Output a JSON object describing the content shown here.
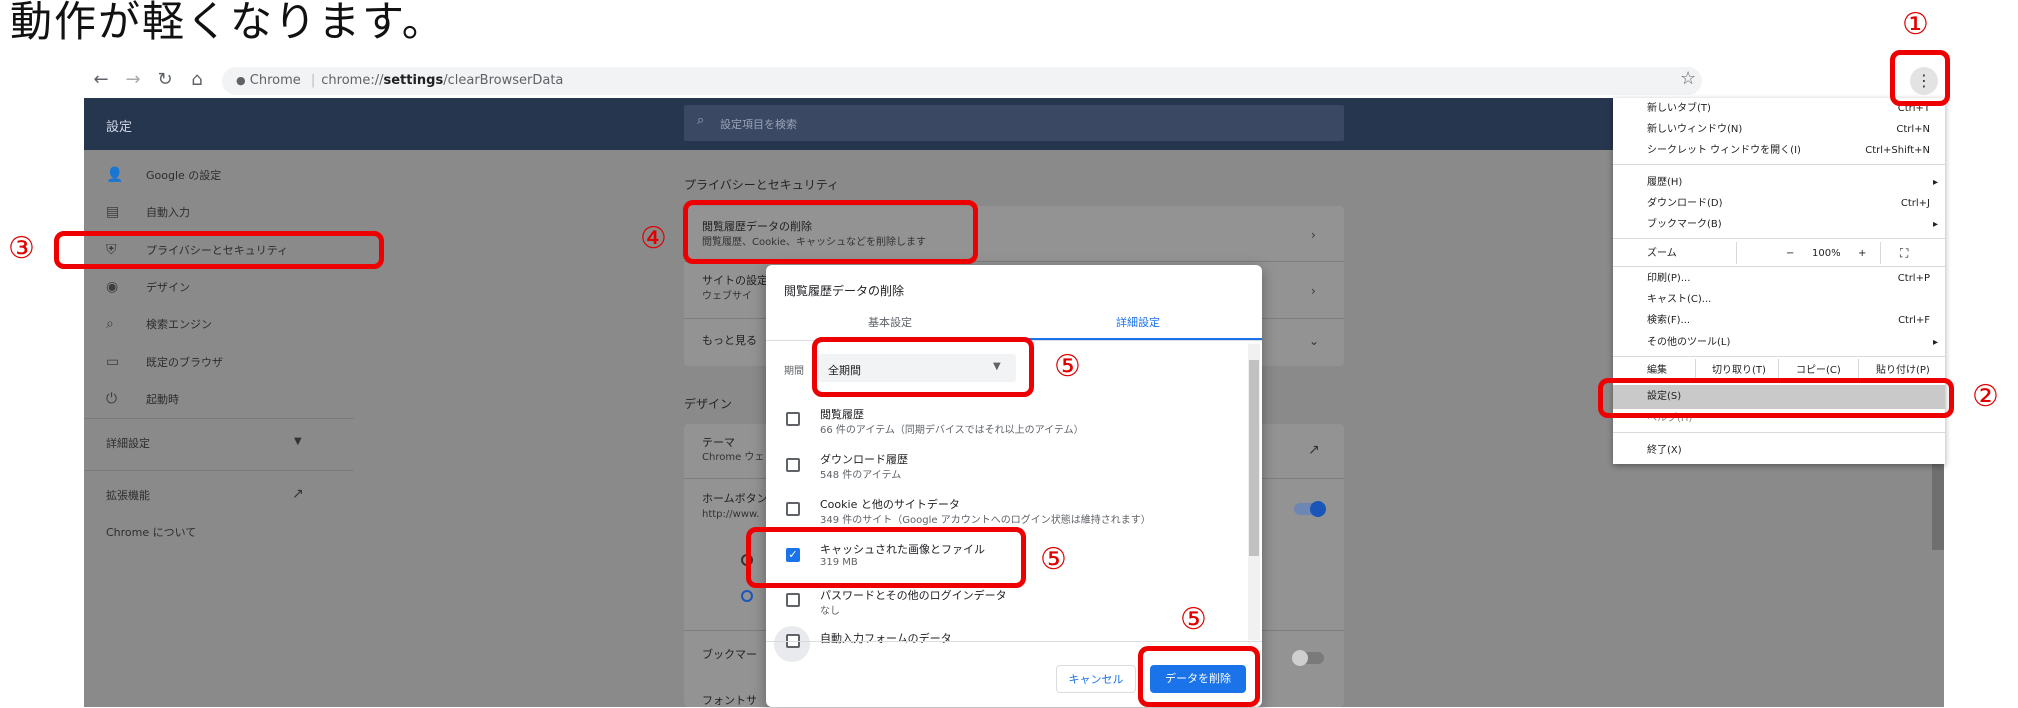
{
  "headline": "動作が軽くなります。",
  "browser": {
    "back_icon": "arrow-left-icon",
    "forward_icon": "arrow-right-icon",
    "reload_icon": "reload-icon",
    "home_icon": "home-icon",
    "site_label": "Chrome",
    "url_prefix": "chrome://",
    "url_bold": "settings",
    "url_suffix": "/clearBrowserData",
    "bookmark_star": "☆",
    "menu_dots": "⋮"
  },
  "settings": {
    "title": "設定",
    "search_placeholder": "設定項目を検索",
    "sidebar": [
      {
        "label": "Google の設定",
        "icon": "person-icon"
      },
      {
        "label": "自動入力",
        "icon": "clipboard-icon"
      },
      {
        "label": "プライバシーとセキュリティ",
        "icon": "shield-icon"
      },
      {
        "label": "デザイン",
        "icon": "palette-icon"
      },
      {
        "label": "検索エンジン",
        "icon": "search-icon"
      },
      {
        "label": "既定のブラウザ",
        "icon": "browser-icon"
      },
      {
        "label": "起動時",
        "icon": "power-icon"
      }
    ],
    "advanced": "詳細設定",
    "extensions": "拡張機能",
    "about": "Chrome について",
    "privacy_section": "プライバシーとセキュリティ",
    "clear_title": "閲覧履歴データの削除",
    "clear_sub": "閲覧履歴、Cookie、キャッシュなどを削除します",
    "site_settings_title": "サイトの設定",
    "site_settings_sub": "ウェブサイ",
    "more": "もっと見る",
    "design_section": "デザイン",
    "theme_title": "テーマ",
    "theme_sub": "Chrome ウェ",
    "home_button_title": "ホームボタン",
    "home_button_sub": "http://www.",
    "bookmark_bar": "ブックマー",
    "font_size": "フォントサ"
  },
  "menu": {
    "items": [
      {
        "label": "新しいタブ(T)",
        "shortcut": "Ctrl+T"
      },
      {
        "label": "新しいウィンドウ(N)",
        "shortcut": "Ctrl+N"
      },
      {
        "label": "シークレット ウィンドウを開く(I)",
        "shortcut": "Ctrl+Shift+N"
      },
      {
        "label": "履歴(H)",
        "shortcut": "▸"
      },
      {
        "label": "ダウンロード(D)",
        "shortcut": "Ctrl+J"
      },
      {
        "label": "ブックマーク(B)",
        "shortcut": "▸"
      },
      {
        "label": "印刷(P)...",
        "shortcut": "Ctrl+P"
      },
      {
        "label": "キャスト(C)...",
        "shortcut": ""
      },
      {
        "label": "検索(F)...",
        "shortcut": "Ctrl+F"
      },
      {
        "label": "その他のツール(L)",
        "shortcut": "▸"
      },
      {
        "label": "設定(S)",
        "shortcut": ""
      },
      {
        "label": "ヘルプ(H)",
        "shortcut": "▸"
      },
      {
        "label": "終了(X)",
        "shortcut": ""
      }
    ],
    "zoom_label": "ズーム",
    "zoom_minus": "−",
    "zoom_value": "100%",
    "zoom_plus": "+",
    "fullscreen": "⛶",
    "edit_label": "編集",
    "cut": "切り取り(T)",
    "copy": "コピー(C)",
    "paste": "貼り付け(P)"
  },
  "dialog": {
    "title": "閲覧履歴データの削除",
    "tab_basic": "基本設定",
    "tab_advanced": "詳細設定",
    "period_label": "期間",
    "period_value": "全期間",
    "items": [
      {
        "title": "閲覧履歴",
        "sub": "66 件のアイテム（同期デバイスではそれ以上のアイテム）",
        "checked": false
      },
      {
        "title": "ダウンロード履歴",
        "sub": "548 件のアイテム",
        "checked": false
      },
      {
        "title": "Cookie と他のサイトデータ",
        "sub": "349 件のサイト（Google アカウントへのログイン状態は維持されます）",
        "checked": false
      },
      {
        "title": "キャッシュされた画像とファイル",
        "sub": "319 MB",
        "checked": true
      },
      {
        "title": "パスワードとその他のログインデータ",
        "sub": "なし",
        "checked": false
      },
      {
        "title": "自動入力フォームのデータ",
        "sub": "",
        "checked": false
      }
    ],
    "cancel": "キャンセル",
    "delete": "データを削除"
  },
  "annotations": {
    "n1": "①",
    "n2": "②",
    "n3": "③",
    "n4": "④",
    "n5a": "⑤",
    "n5b": "⑤",
    "n5c": "⑤"
  },
  "colors": {
    "header": "#27364f",
    "highlight": "#ee0000",
    "accent": "#1a73e8"
  }
}
